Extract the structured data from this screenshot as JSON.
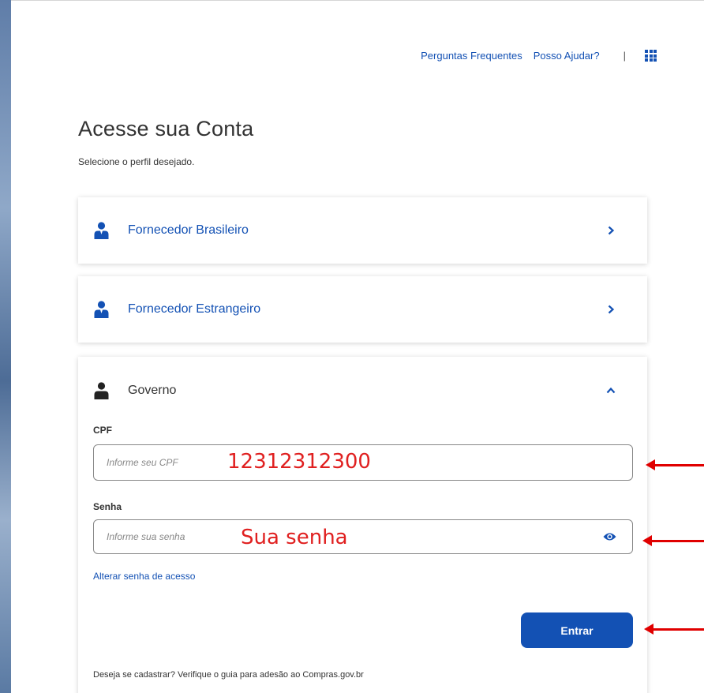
{
  "header": {
    "faq_label": "Perguntas Frequentes",
    "help_label": "Posso Ajudar?",
    "separator": "|"
  },
  "page": {
    "title": "Acesse sua Conta",
    "subtitle": "Selecione o perfil desejado."
  },
  "profiles": [
    {
      "label": "Fornecedor Brasileiro"
    },
    {
      "label": "Fornecedor Estrangeiro"
    },
    {
      "label": "Governo"
    }
  ],
  "form": {
    "cpf_label": "CPF",
    "cpf_placeholder": "Informe seu CPF",
    "cpf_annotation": "12312312300",
    "password_label": "Senha",
    "password_placeholder": "Informe sua senha",
    "password_annotation": "Sua senha",
    "change_password_link": "Alterar senha de acesso",
    "submit_label": "Entrar",
    "signup_text": "Deseja se cadastrar? Verifique o guia para adesão ao Compras.gov.br"
  },
  "colors": {
    "accent": "#1351b4",
    "annotation": "#e02020"
  }
}
